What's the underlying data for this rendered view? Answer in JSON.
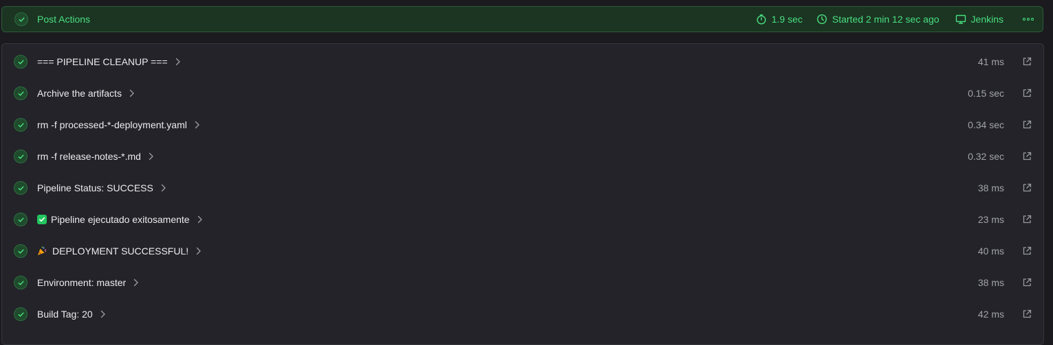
{
  "header": {
    "title": "Post Actions",
    "duration": "1.9 sec",
    "started": "Started 2 min 12 sec ago",
    "agent": "Jenkins",
    "icons": {
      "status": "check-icon",
      "duration": "timer-icon",
      "started": "clock-icon",
      "agent": "monitor-icon",
      "more": "more-icon"
    }
  },
  "steps": [
    {
      "label": "=== PIPELINE CLEANUP ===",
      "time": "41 ms"
    },
    {
      "label": "Archive the artifacts",
      "time": "0.15 sec"
    },
    {
      "label": "rm -f processed-*-deployment.yaml",
      "time": "0.34 sec"
    },
    {
      "label": "rm -f release-notes-*.md",
      "time": "0.32 sec"
    },
    {
      "label": "Pipeline Status: SUCCESS",
      "time": "38 ms"
    },
    {
      "label": "Pipeline ejecutado exitosamente",
      "time": "23 ms",
      "emoji": "check-mark-button-emoji"
    },
    {
      "label": "DEPLOYMENT SUCCESSFUL!",
      "time": "40 ms",
      "emoji": "party-popper-emoji"
    },
    {
      "label": "Environment: master",
      "time": "38 ms"
    },
    {
      "label": "Build Tag: 20",
      "time": "42 ms"
    }
  ],
  "colors": {
    "success": "#4ade80",
    "header_bg": "#1b3522",
    "panel_bg": "#232329",
    "text": "#ececf0",
    "muted": "#a3a3ab"
  }
}
